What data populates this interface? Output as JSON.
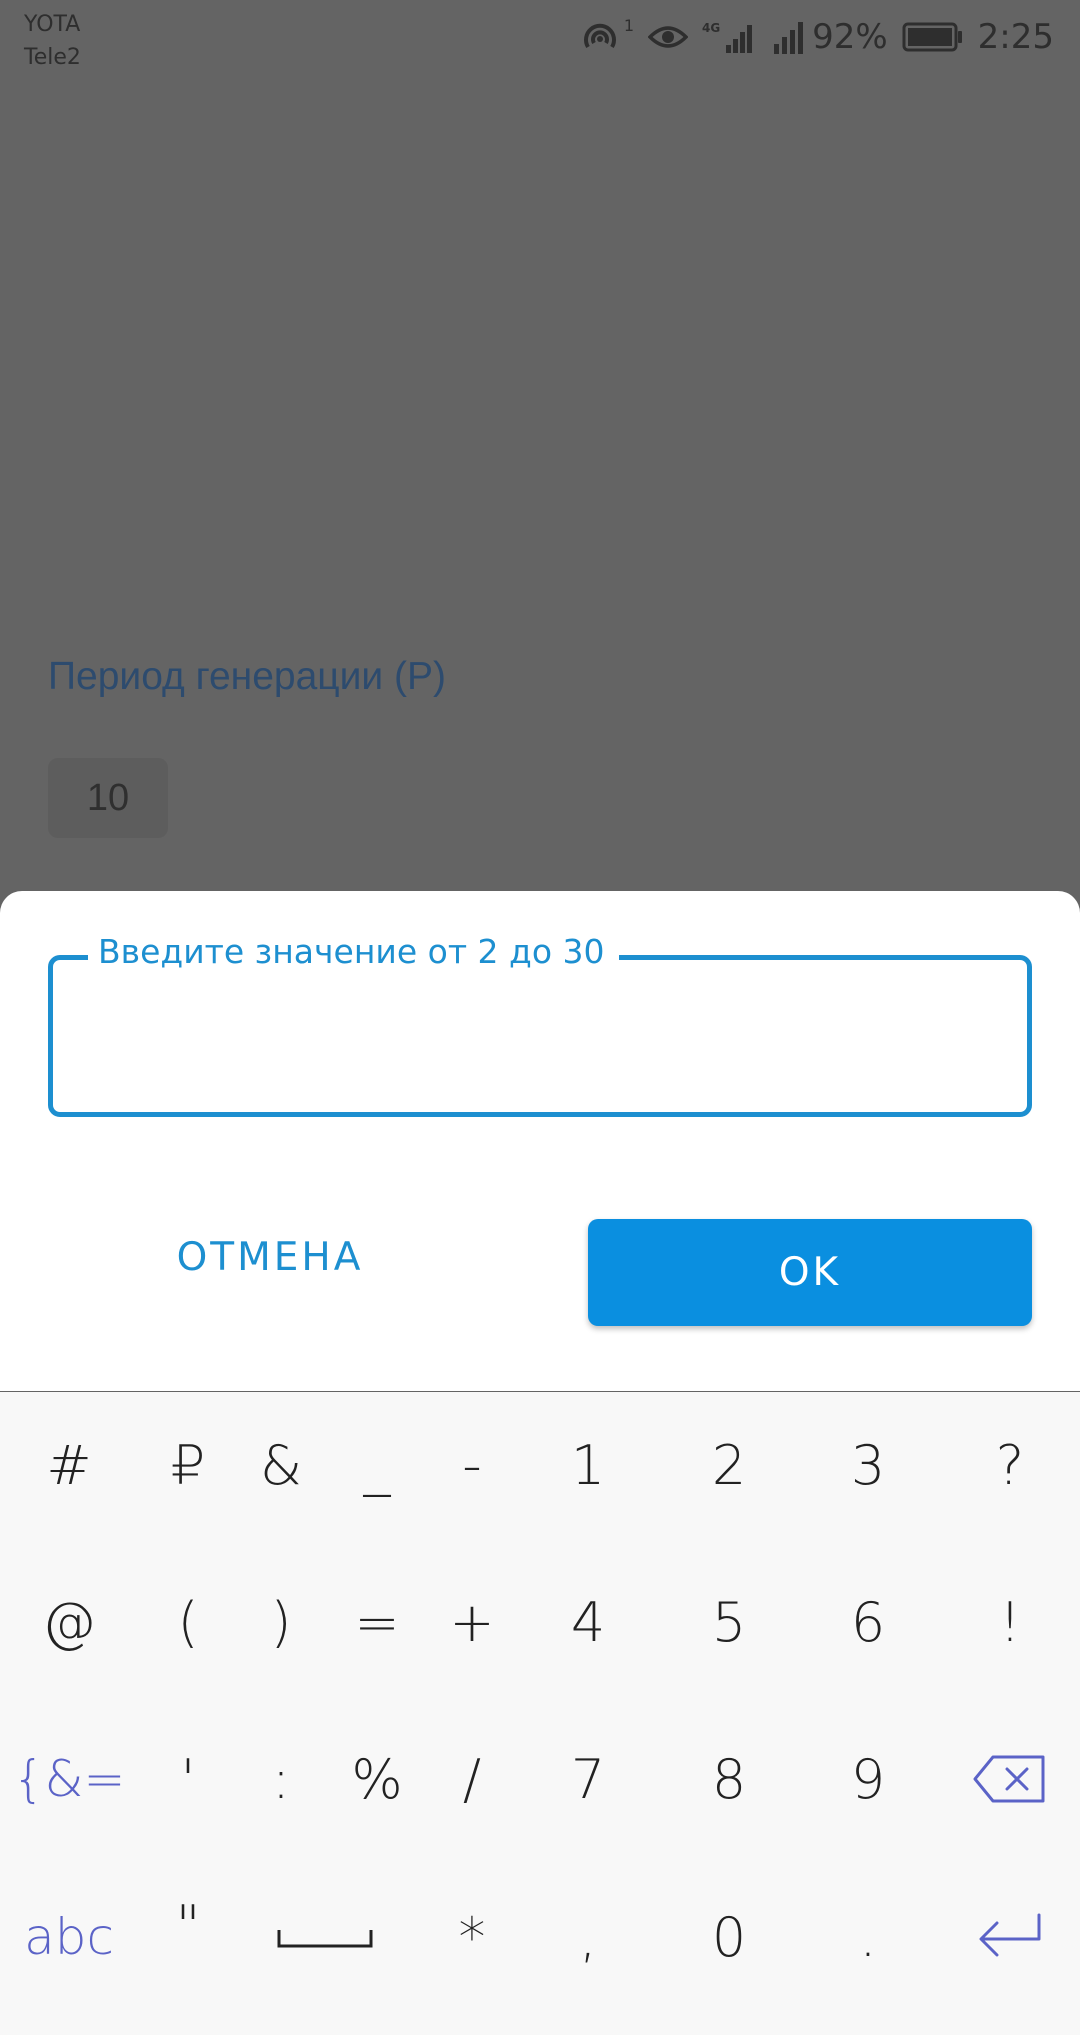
{
  "status_bar": {
    "carrier_1": "YOTA",
    "carrier_2": "Tele2",
    "hotspot_sup": "1",
    "network": "4G",
    "battery": "92%",
    "time": "2:25"
  },
  "background": {
    "label": "Период генерации (P)",
    "value": "10"
  },
  "dialog": {
    "field_label": "Введите значение от 2 до 30",
    "field_value": "",
    "cancel_label": "ОТМЕНА",
    "ok_label": "OK"
  },
  "keyboard": {
    "row1": [
      "#",
      "₽",
      "&",
      "_",
      "-",
      "1",
      "2",
      "3",
      "?"
    ],
    "row2": [
      "@",
      "(",
      ")",
      "=",
      "+",
      "4",
      "5",
      "6",
      "!"
    ],
    "row3": [
      "{&=",
      "'",
      ":",
      "%",
      "/",
      "7",
      "8",
      "9"
    ],
    "row4": [
      "abc",
      "\"",
      "*",
      ",",
      "0",
      "."
    ]
  },
  "colors": {
    "accent": "#1d8fd0",
    "ok_button": "#0a8fe0",
    "keyboard_accent": "#5b63c7"
  }
}
